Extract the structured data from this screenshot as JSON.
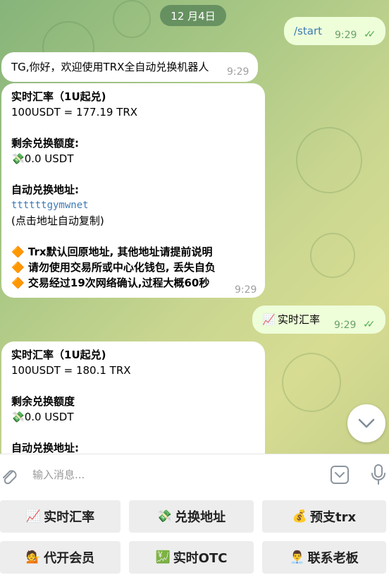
{
  "date_chip": "12 月4日",
  "messages": {
    "start": {
      "text": "/start",
      "time": "9:29"
    },
    "welcome": {
      "text": "TG,你好，欢迎使用TRX全自动兑换机器人",
      "time": "9:29"
    },
    "rate1": {
      "title": "实时汇率（1U起兑)",
      "rate": "100USDT = 177.19 TRX",
      "remain_label": "剩余兑换额度:",
      "remain_value": "0.0 USDT",
      "addr_label": "自动兑换地址:",
      "address": "ttttttgymwnet",
      "copy_hint": "(点击地址自动复制)",
      "note1": "Trx默认回原地址, 其他地址请提前说明",
      "note2": "请勿使用交易所或中心化钱包, 丢失自负",
      "note3": "交易经过19次网络确认,过程大概60秒",
      "time": "9:29"
    },
    "rate_cmd": {
      "text": "实时汇率",
      "time": "9:29"
    },
    "rate2": {
      "title": "实时汇率（1U起兑)",
      "rate": "100USDT = 180.1 TRX",
      "remain_label": "剩余兑换额度",
      "remain_value": "0.0 USDT",
      "addr_label": "自动兑换地址:"
    }
  },
  "input": {
    "placeholder": "输入消息..."
  },
  "keyboard": {
    "row1": [
      {
        "icon": "📈",
        "label": "实时汇率"
      },
      {
        "icon": "💸",
        "label": "兑换地址"
      },
      {
        "icon": "💰",
        "label": "预支trx"
      }
    ],
    "row2": [
      {
        "icon": "💁",
        "label": "代开会员"
      },
      {
        "icon": "💹",
        "label": "实时OTC"
      },
      {
        "icon": "👨‍💼",
        "label": "联系老板"
      }
    ]
  }
}
